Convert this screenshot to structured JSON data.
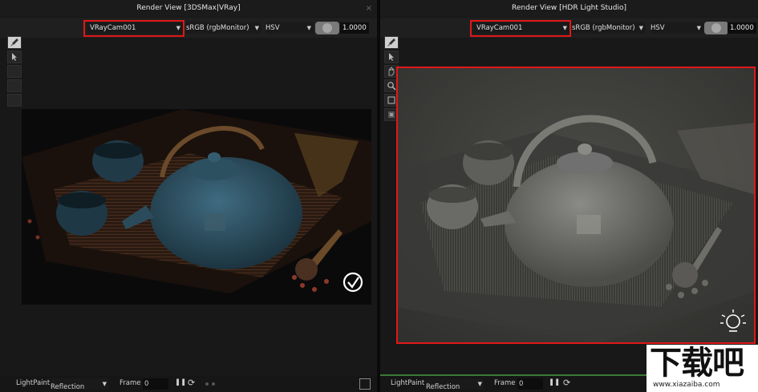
{
  "left_panel": {
    "title": "Render View [3DSMax|VRay]",
    "close": "×",
    "camera": "VRayCam001",
    "colorspace": "sRGB (rgbMonitor)",
    "colormode": "HSV",
    "exposure": "1.0000",
    "status": {
      "lightpaint_label": "LightPaint",
      "mode": "Reflection",
      "frame_label": "Frame",
      "frame_value": "0"
    }
  },
  "right_panel": {
    "title": "Render View [HDR Light Studio]",
    "camera": "VRayCam001",
    "colorspace": "sRGB (rgbMonitor)",
    "colormode": "HSV",
    "exposure": "1.0000",
    "status": {
      "lightpaint_label": "LightPaint",
      "mode": "Reflection",
      "frame_label": "Frame",
      "frame_value": "0"
    }
  },
  "icons": [
    "paint-brush-icon",
    "arrow-select-icon",
    "hand-pan-icon",
    "zoom-icon",
    "crop-icon",
    "fit-view-icon",
    "pause-icon",
    "refresh-icon",
    "vray-logo-icon",
    "lightbulb-icon",
    "exit-icon"
  ],
  "colors": {
    "highlight": "#e01818",
    "progress": "#3a7a36",
    "teapot_left": "#2e5263"
  },
  "watermark": {
    "main": "下载吧",
    "url": "www.xiazaiba.com"
  }
}
